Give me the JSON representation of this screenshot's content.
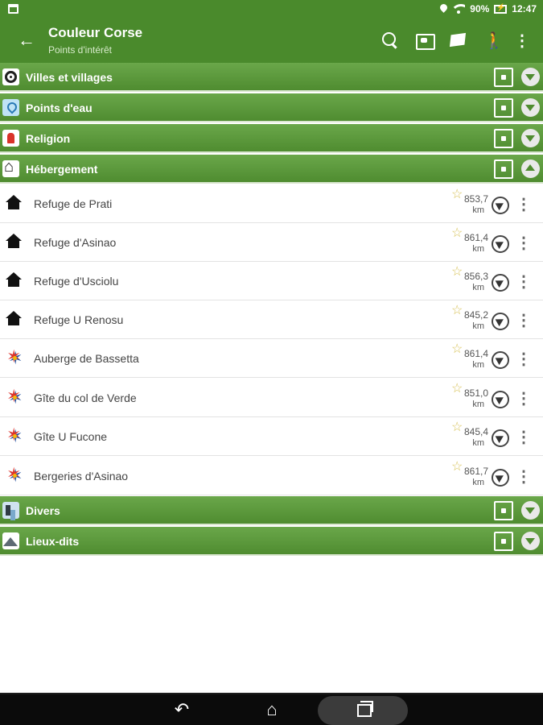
{
  "status_bar": {
    "battery": "90%",
    "time": "12:47"
  },
  "app_bar": {
    "title": "Couleur Corse",
    "subtitle": "Points d'intérêt",
    "back_icon": "arrow-left-icon",
    "actions": [
      "search-icon",
      "map-view-icon",
      "map-icon",
      "hiker-icon",
      "more-vert-icon"
    ],
    "more_glyph": "⋮",
    "hiker_glyph": "🚶"
  },
  "categories": [
    {
      "label": "Villes et villages",
      "icon": "ring-icon",
      "expanded": false
    },
    {
      "label": "Points d'eau",
      "icon": "water-drop-icon",
      "expanded": false
    },
    {
      "label": "Religion",
      "icon": "church-icon",
      "expanded": false
    },
    {
      "label": "Hébergement",
      "icon": "house-icon",
      "expanded": true
    },
    {
      "label": "Divers",
      "icon": "divers-icon",
      "expanded": false
    },
    {
      "label": "Lieux-dits",
      "icon": "mountain-icon",
      "expanded": false
    }
  ],
  "items": [
    {
      "name": "Refuge de Prati",
      "distance": "853,7",
      "unit": "km",
      "icon": "house-icon"
    },
    {
      "name": "Refuge d'Asinao",
      "distance": "861,4",
      "unit": "km",
      "icon": "house-icon"
    },
    {
      "name": "Refuge d'Usciolu",
      "distance": "856,3",
      "unit": "km",
      "icon": "house-icon"
    },
    {
      "name": "Refuge U Renosu",
      "distance": "845,2",
      "unit": "km",
      "icon": "house-icon"
    },
    {
      "name": "Auberge de Bassetta",
      "distance": "861,4",
      "unit": "km",
      "icon": "star-logo-icon"
    },
    {
      "name": "Gîte du col de Verde",
      "distance": "851,0",
      "unit": "km",
      "icon": "star-logo-icon"
    },
    {
      "name": "Gîte U Fucone",
      "distance": "845,4",
      "unit": "km",
      "icon": "star-logo-icon"
    },
    {
      "name": "Bergeries d'Asinao",
      "distance": "861,7",
      "unit": "km",
      "icon": "star-logo-icon"
    }
  ],
  "glyphs": {
    "fav": "☆",
    "more": "⋮",
    "back": "←",
    "nav_back": "↶",
    "nav_home": "⌂"
  },
  "colors": {
    "accent": "#4a8a2c",
    "header_gradient_top": "#6aa74a",
    "header_gradient_bottom": "#4f8c30"
  }
}
